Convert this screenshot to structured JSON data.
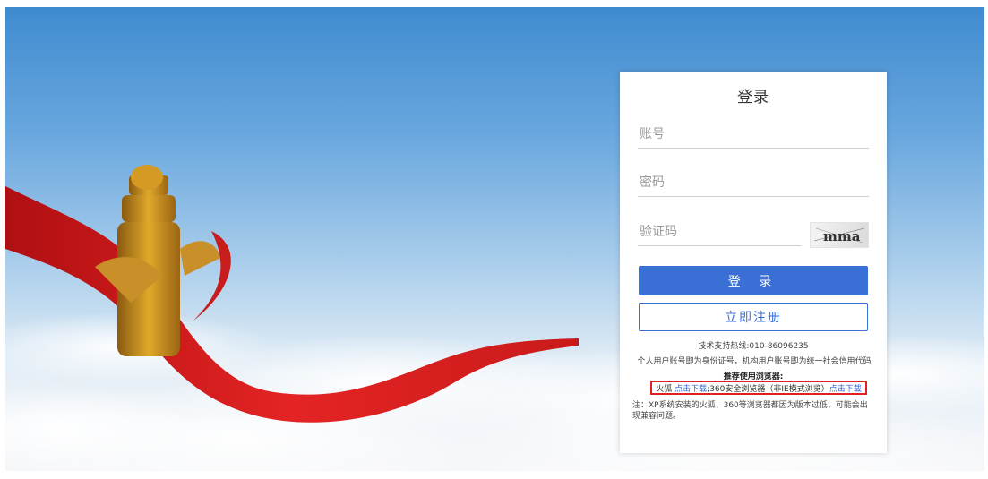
{
  "login": {
    "title": "登录",
    "account_placeholder": "账号",
    "password_placeholder": "密码",
    "captcha_placeholder": "验证码",
    "captcha_text": "mma",
    "login_button": "登 录",
    "register_button": "立即注册",
    "support_line": "技术支持热线:010-86096235",
    "account_note": "个人用户账号即为身份证号，机构用户账号即为统一社会信用代码",
    "recommend_title": "推荐使用浏览器:",
    "browser_firefox": "火狐",
    "download_link_1": "点击下载",
    "browser_360": ";360安全浏览器（非IE模式浏览）",
    "download_link_2": "点击下载",
    "xp_note": "注：XP系统安装的火狐，360等浏览器都因为版本过低，可能会出现兼容问题。"
  },
  "colors": {
    "primary": "#3a6fd6",
    "highlight_border": "#e02020",
    "ribbon": "#d81e1e"
  }
}
